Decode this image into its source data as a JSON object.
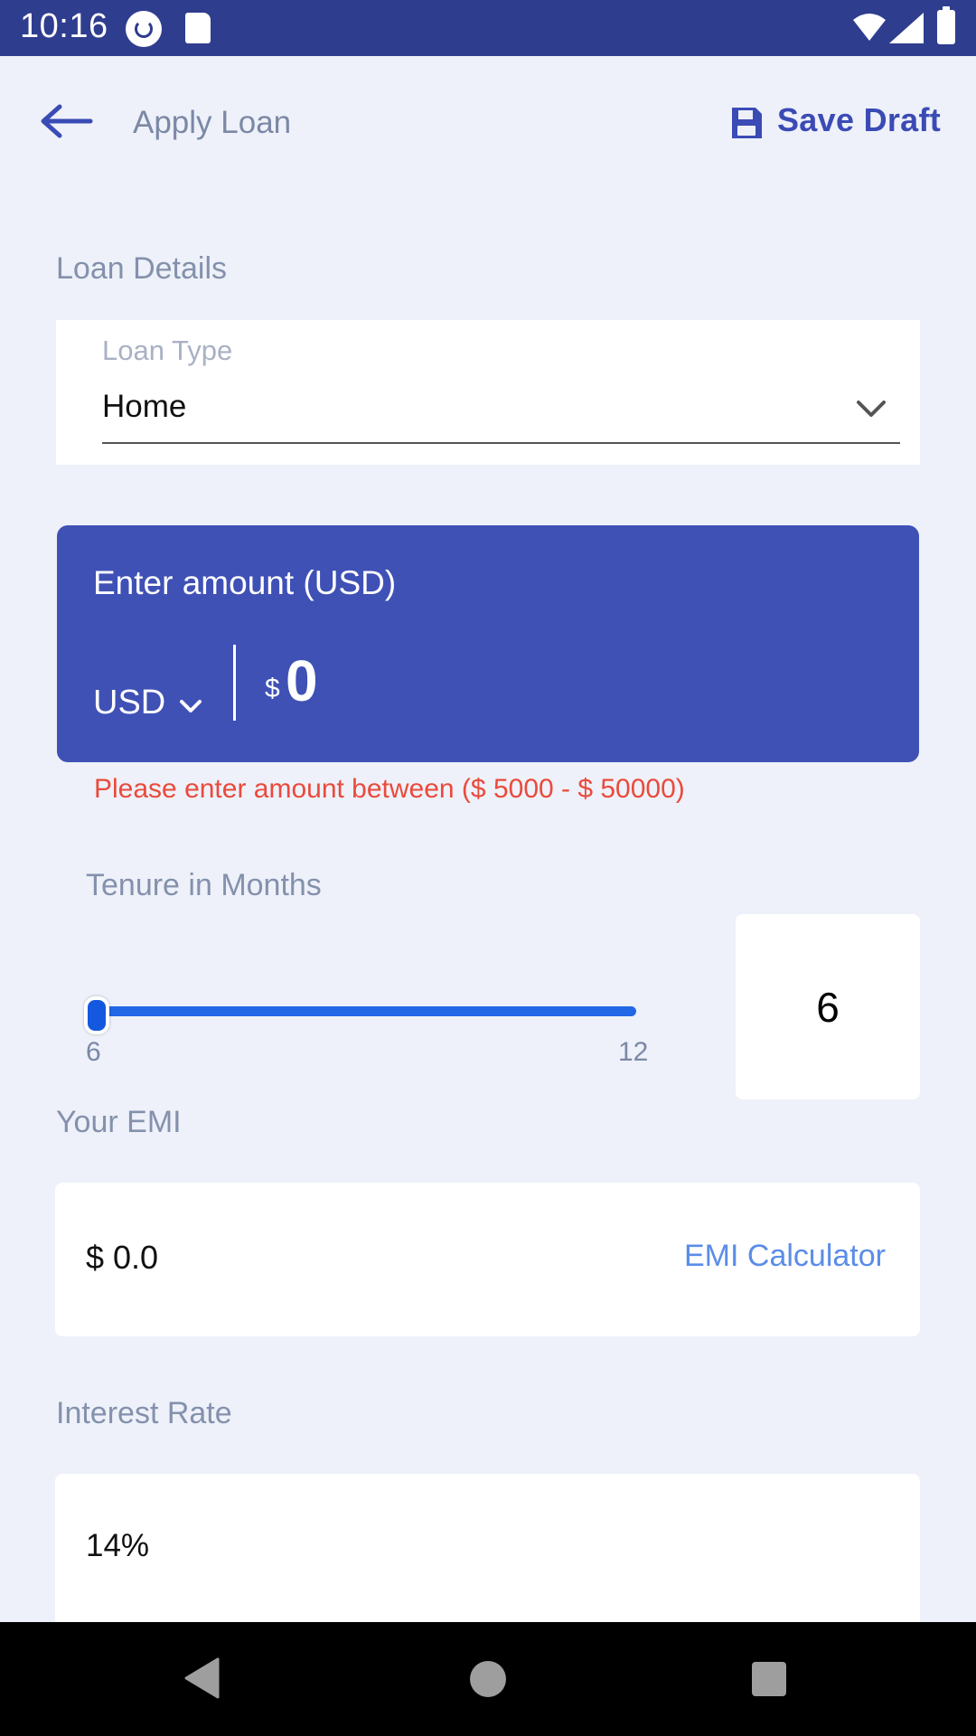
{
  "status_bar": {
    "time": "10:16"
  },
  "header": {
    "title": "Apply Loan",
    "save_label": "Save Draft"
  },
  "loan_details": {
    "section_label": "Loan Details",
    "loan_type_caption": "Loan Type",
    "loan_type_value": "Home"
  },
  "amount": {
    "title": "Enter amount (USD)",
    "currency": "USD",
    "currency_symbol": "$",
    "value": "0",
    "error": "Please enter amount between ($ 5000 - $ 50000)"
  },
  "tenure": {
    "label": "Tenure in Months",
    "min_label": "6",
    "max_label": "12",
    "value": "6",
    "slider_fraction": 0
  },
  "emi": {
    "label": "Your EMI",
    "value": "$ 0.0",
    "calculator_link": "EMI Calculator"
  },
  "interest": {
    "label": "Interest Rate",
    "value": "14%"
  },
  "colors": {
    "primary": "#3f51b5",
    "status_bar": "#2f3d8f",
    "error": "#ea4a3c",
    "link": "#5b8de8",
    "slider": "#2267e6"
  }
}
